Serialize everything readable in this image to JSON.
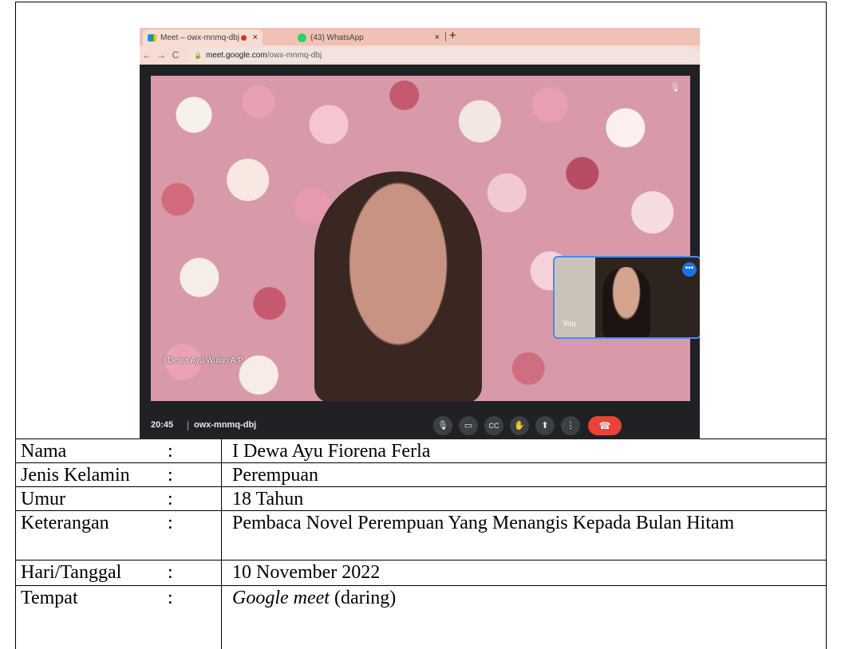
{
  "browser": {
    "active_tab_title": "Meet – owx-mnmq-dbj",
    "second_tab_title": "(43) WhatsApp",
    "tab_close": "×",
    "new_tab": "+",
    "back": "←",
    "forward": "→",
    "reload": "C",
    "url_host": "meet.google.com",
    "url_path": "/owx-mnmq-dbj"
  },
  "meet": {
    "participant_name": "I Dewa Ayu Wulan A.P",
    "self_label": "You",
    "self_more": "•••",
    "clock": "20:45",
    "meeting_code": "owx-mnmq-dbj",
    "controls": [
      {
        "name": "mic-icon",
        "glyph": "🎙"
      },
      {
        "name": "camera-icon",
        "glyph": "▭"
      },
      {
        "name": "captions-icon",
        "glyph": "CC"
      },
      {
        "name": "raise-hand-icon",
        "glyph": "✋"
      },
      {
        "name": "present-icon",
        "glyph": "⬆"
      },
      {
        "name": "more-options-icon",
        "glyph": "⋮"
      },
      {
        "name": "end-call-icon",
        "glyph": "☎"
      }
    ]
  },
  "rows": [
    {
      "label": "Nama",
      "colon": ":",
      "value": "I Dewa Ayu Fiorena Ferla"
    },
    {
      "label": "Jenis Kelamin",
      "colon": ":",
      "value": "Perempuan"
    },
    {
      "label": "Umur",
      "colon": ":",
      "value": "18 Tahun"
    },
    {
      "label": "Keterangan",
      "colon": ":",
      "value": "Pembaca Novel Perempuan Yang Menangis Kepada Bulan Hitam"
    },
    {
      "label": "Hari/Tanggal",
      "colon": ":",
      "value": "10 November 2022"
    },
    {
      "label": "Tempat",
      "colon": ":",
      "value_italic": "Google meet",
      "value_rest": " (daring)"
    }
  ]
}
